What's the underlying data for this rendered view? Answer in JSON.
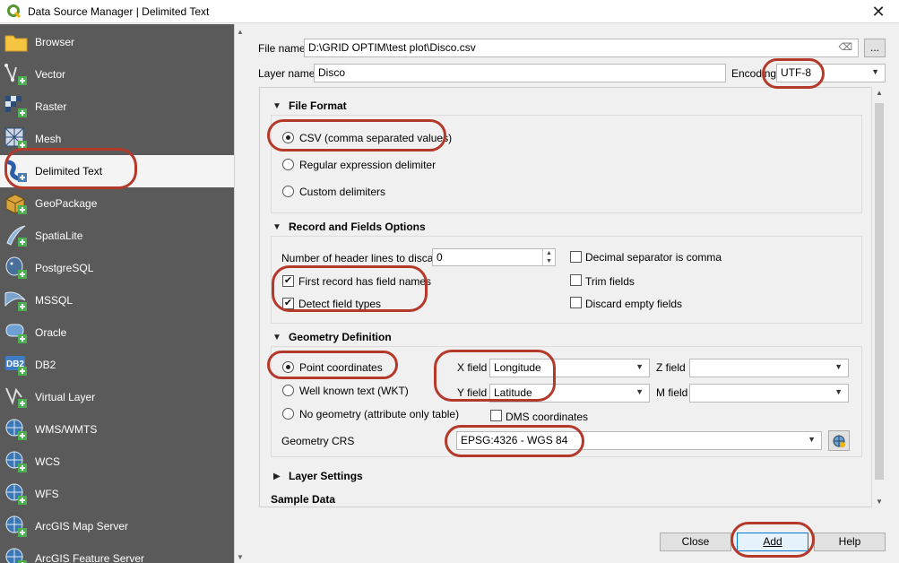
{
  "window": {
    "title": "Data Source Manager | Delimited Text"
  },
  "sidebar": {
    "items": [
      {
        "label": "Browser",
        "icon": "folder-icon"
      },
      {
        "label": "Vector",
        "icon": "vector-icon"
      },
      {
        "label": "Raster",
        "icon": "raster-icon"
      },
      {
        "label": "Mesh",
        "icon": "mesh-icon"
      },
      {
        "label": "Delimited Text",
        "icon": "delimited-text-icon"
      },
      {
        "label": "GeoPackage",
        "icon": "geopackage-icon"
      },
      {
        "label": "SpatiaLite",
        "icon": "spatialite-icon"
      },
      {
        "label": "PostgreSQL",
        "icon": "postgresql-icon"
      },
      {
        "label": "MSSQL",
        "icon": "mssql-icon"
      },
      {
        "label": "Oracle",
        "icon": "oracle-icon"
      },
      {
        "label": "DB2",
        "icon": "db2-icon"
      },
      {
        "label": "Virtual Layer",
        "icon": "virtual-layer-icon"
      },
      {
        "label": "WMS/WMTS",
        "icon": "wms-icon"
      },
      {
        "label": "WCS",
        "icon": "wcs-icon"
      },
      {
        "label": "WFS",
        "icon": "wfs-icon"
      },
      {
        "label": "ArcGIS Map Server",
        "icon": "arcgis-map-icon"
      },
      {
        "label": "ArcGIS Feature Server",
        "icon": "arcgis-feature-icon"
      }
    ],
    "db2_text": "DB2"
  },
  "form": {
    "file_name_label": "File name",
    "file_name_value": "D:\\GRID OPTIM\\test plot\\Disco.csv",
    "browse_label": "...",
    "layer_name_label": "Layer name",
    "layer_name_value": "Disco",
    "encoding_label": "Encoding",
    "encoding_value": "UTF-8"
  },
  "file_format": {
    "title": "File Format",
    "csv": "CSV (comma separated values)",
    "regex": "Regular expression delimiter",
    "custom": "Custom delimiters"
  },
  "record_options": {
    "title": "Record and Fields Options",
    "header_lines_label": "Number of header lines to discard",
    "header_lines_value": "0",
    "decimal_comma": "Decimal separator is comma",
    "first_record": "First record has field names",
    "trim_fields": "Trim fields",
    "detect_types": "Detect field types",
    "discard_empty": "Discard empty fields",
    "check_mark": "✔"
  },
  "geometry": {
    "title": "Geometry Definition",
    "point_coords": "Point coordinates",
    "wkt": "Well known text (WKT)",
    "no_geometry": "No geometry (attribute only table)",
    "x_label": "X field",
    "x_value": "Longitude",
    "y_label": "Y field",
    "y_value": "Latitude",
    "z_label": "Z field",
    "z_value": "",
    "m_label": "M field",
    "m_value": "",
    "dms": "DMS coordinates",
    "crs_label": "Geometry CRS",
    "crs_value": "EPSG:4326 - WGS 84"
  },
  "layer_settings": {
    "title": "Layer Settings"
  },
  "sample_data": {
    "title": "Sample Data"
  },
  "buttons": {
    "close": "Close",
    "add": "Add",
    "help": "Help"
  },
  "colors": {
    "sidebar_bg": "#5a5a5a",
    "annotation": "#b5392b",
    "accent": "#0078d7"
  }
}
